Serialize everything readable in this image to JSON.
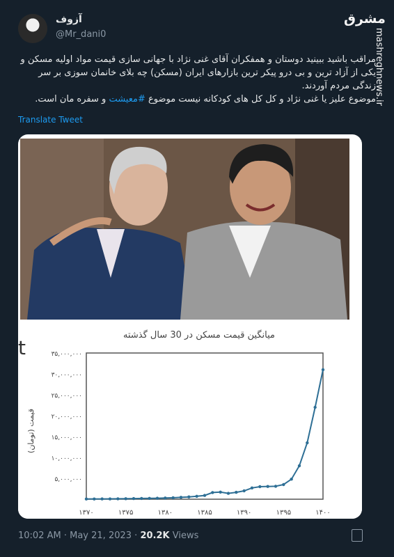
{
  "user": {
    "display_name": "آزوف",
    "handle": "@Mr_dani0"
  },
  "source": {
    "logo": "مشرق",
    "watermark": "mashreghnews.ir"
  },
  "tweet": {
    "line1": "مراقب باشید ببینید دوستان و همفکران آقای غنی نژاد با جهانی سازی قیمت مواد اولیه مسکن و یکی از آزاد ترین و بی درو پیکر ترین بازارهای ایران (مسکن) چه بلای خانمان سوزی بر سر زندگی مردم آوردند.",
    "line2_before": "موضوع علیز یا غنی نژاد و کل کل های کودکانه نیست موضوع",
    "line2_hashtag": "#معیشت",
    "line2_after": "و سفره مان است.",
    "translate": "Translate Tweet"
  },
  "meta": {
    "time": "10:02 AM",
    "date": "May 21, 2023",
    "views_count": "20.2K",
    "views_label": "Views"
  },
  "colors": {
    "accent": "#1d9bf0",
    "background": "#15202b"
  },
  "chart_data": {
    "type": "line",
    "title": "میانگین قیمت مسکن در 30 سال گذشته",
    "ylabel": "قیمت (تومان)",
    "xlabel": "",
    "x": [
      1370,
      1371,
      1372,
      1373,
      1374,
      1375,
      1376,
      1377,
      1378,
      1379,
      1380,
      1381,
      1382,
      1383,
      1384,
      1385,
      1386,
      1387,
      1388,
      1389,
      1390,
      1391,
      1392,
      1393,
      1394,
      1395,
      1396,
      1397,
      1398,
      1399,
      1400
    ],
    "values": [
      50000,
      60000,
      70000,
      80000,
      100000,
      120000,
      150000,
      180000,
      200000,
      230000,
      280000,
      350000,
      450000,
      550000,
      700000,
      900000,
      1600000,
      1700000,
      1400000,
      1650000,
      2000000,
      2700000,
      3000000,
      3050000,
      3100000,
      3500000,
      4800000,
      8000000,
      13500000,
      22000000,
      31000000
    ],
    "xticks": [
      "۱۳۷۰",
      "۱۳۷۵",
      "۱۳۸۰",
      "۱۳۸۵",
      "۱۳۹۰",
      "۱۳۹۵",
      "۱۴۰۰"
    ],
    "xtick_values": [
      1370,
      1375,
      1380,
      1385,
      1390,
      1395,
      1400
    ],
    "yticks": [
      "۵,۰۰۰,۰۰۰",
      "۱۰,۰۰۰,۰۰۰",
      "۱۵,۰۰۰,۰۰۰",
      "۲۰,۰۰۰,۰۰۰",
      "۲۵,۰۰۰,۰۰۰",
      "۳۰,۰۰۰,۰۰۰",
      "۳۵,۰۰۰,۰۰۰"
    ],
    "ytick_values": [
      5000000,
      10000000,
      15000000,
      20000000,
      25000000,
      30000000,
      35000000
    ],
    "xlim": [
      1370,
      1400
    ],
    "ylim": [
      0,
      35000000
    ],
    "grid": false,
    "line_color": "#2e6f95"
  }
}
